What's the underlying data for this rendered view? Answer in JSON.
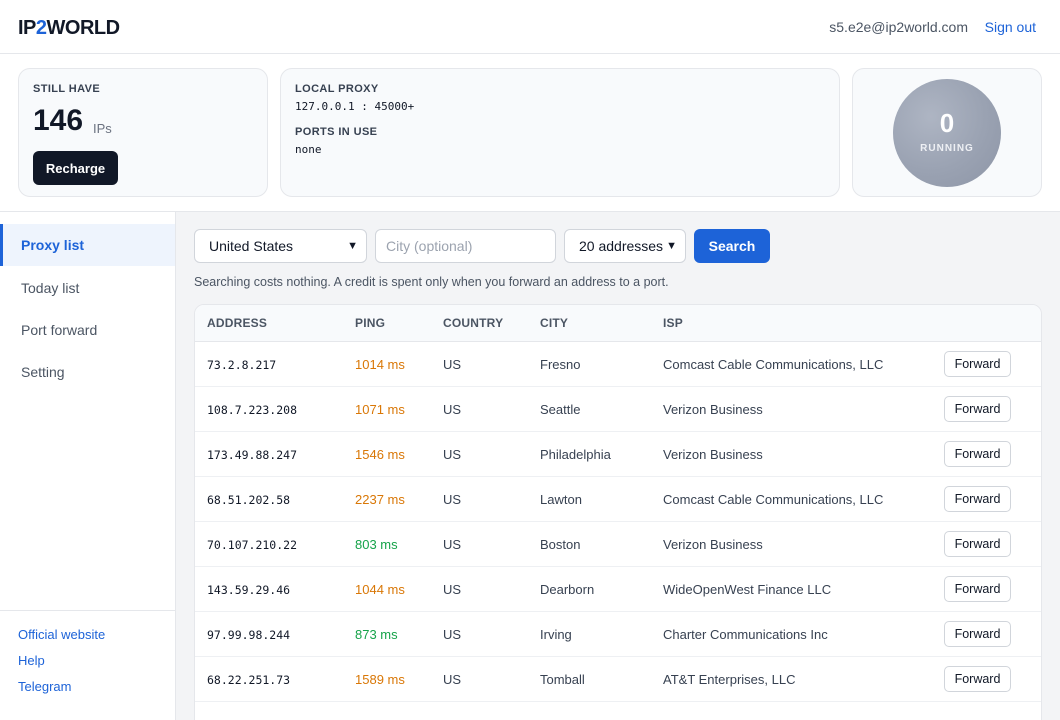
{
  "header": {
    "logo_prefix": "IP",
    "logo_two": "2",
    "logo_suffix": "WORLD",
    "user_email": "s5.e2e@ip2world.com",
    "signout_label": "Sign out"
  },
  "credits": {
    "label": "STILL HAVE",
    "count": "146",
    "unit": "IPs",
    "recharge_label": "Recharge"
  },
  "proxy": {
    "local_label": "LOCAL PROXY",
    "local_value": "127.0.0.1 : 45000+",
    "ports_label": "PORTS IN USE",
    "ports_value": "none"
  },
  "running": {
    "count": "0",
    "label": "RUNNING"
  },
  "sidebar": {
    "items": [
      {
        "label": "Proxy list",
        "active": true
      },
      {
        "label": "Today list",
        "active": false
      },
      {
        "label": "Port forward",
        "active": false
      },
      {
        "label": "Setting",
        "active": false
      }
    ],
    "links": [
      "Official website",
      "Help",
      "Telegram"
    ]
  },
  "search": {
    "country_value": "United States",
    "city_placeholder": "City (optional)",
    "count_value": "20 addresses",
    "search_label": "Search",
    "hint": "Searching costs nothing. A credit is spent only when you forward an address to a port."
  },
  "table": {
    "headers": [
      "ADDRESS",
      "PING",
      "COUNTRY",
      "CITY",
      "ISP"
    ],
    "forward_label": "Forward",
    "rows": [
      {
        "address": "73.2.8.217",
        "ping": "1014 ms",
        "ping_color": "#d97706",
        "country": "US",
        "city": "Fresno",
        "isp": "Comcast Cable Communications, LLC"
      },
      {
        "address": "108.7.223.208",
        "ping": "1071 ms",
        "ping_color": "#d97706",
        "country": "US",
        "city": "Seattle",
        "isp": "Verizon Business"
      },
      {
        "address": "173.49.88.247",
        "ping": "1546 ms",
        "ping_color": "#d97706",
        "country": "US",
        "city": "Philadelphia",
        "isp": "Verizon Business"
      },
      {
        "address": "68.51.202.58",
        "ping": "2237 ms",
        "ping_color": "#d97706",
        "country": "US",
        "city": "Lawton",
        "isp": "Comcast Cable Communications, LLC"
      },
      {
        "address": "70.107.210.22",
        "ping": "803 ms",
        "ping_color": "#16a34a",
        "country": "US",
        "city": "Boston",
        "isp": "Verizon Business"
      },
      {
        "address": "143.59.29.46",
        "ping": "1044 ms",
        "ping_color": "#d97706",
        "country": "US",
        "city": "Dearborn",
        "isp": "WideOpenWest Finance LLC"
      },
      {
        "address": "97.99.98.244",
        "ping": "873 ms",
        "ping_color": "#16a34a",
        "country": "US",
        "city": "Irving",
        "isp": "Charter Communications Inc"
      },
      {
        "address": "68.22.251.73",
        "ping": "1589 ms",
        "ping_color": "#d97706",
        "country": "US",
        "city": "Tomball",
        "isp": "AT&T Enterprises, LLC"
      }
    ]
  }
}
